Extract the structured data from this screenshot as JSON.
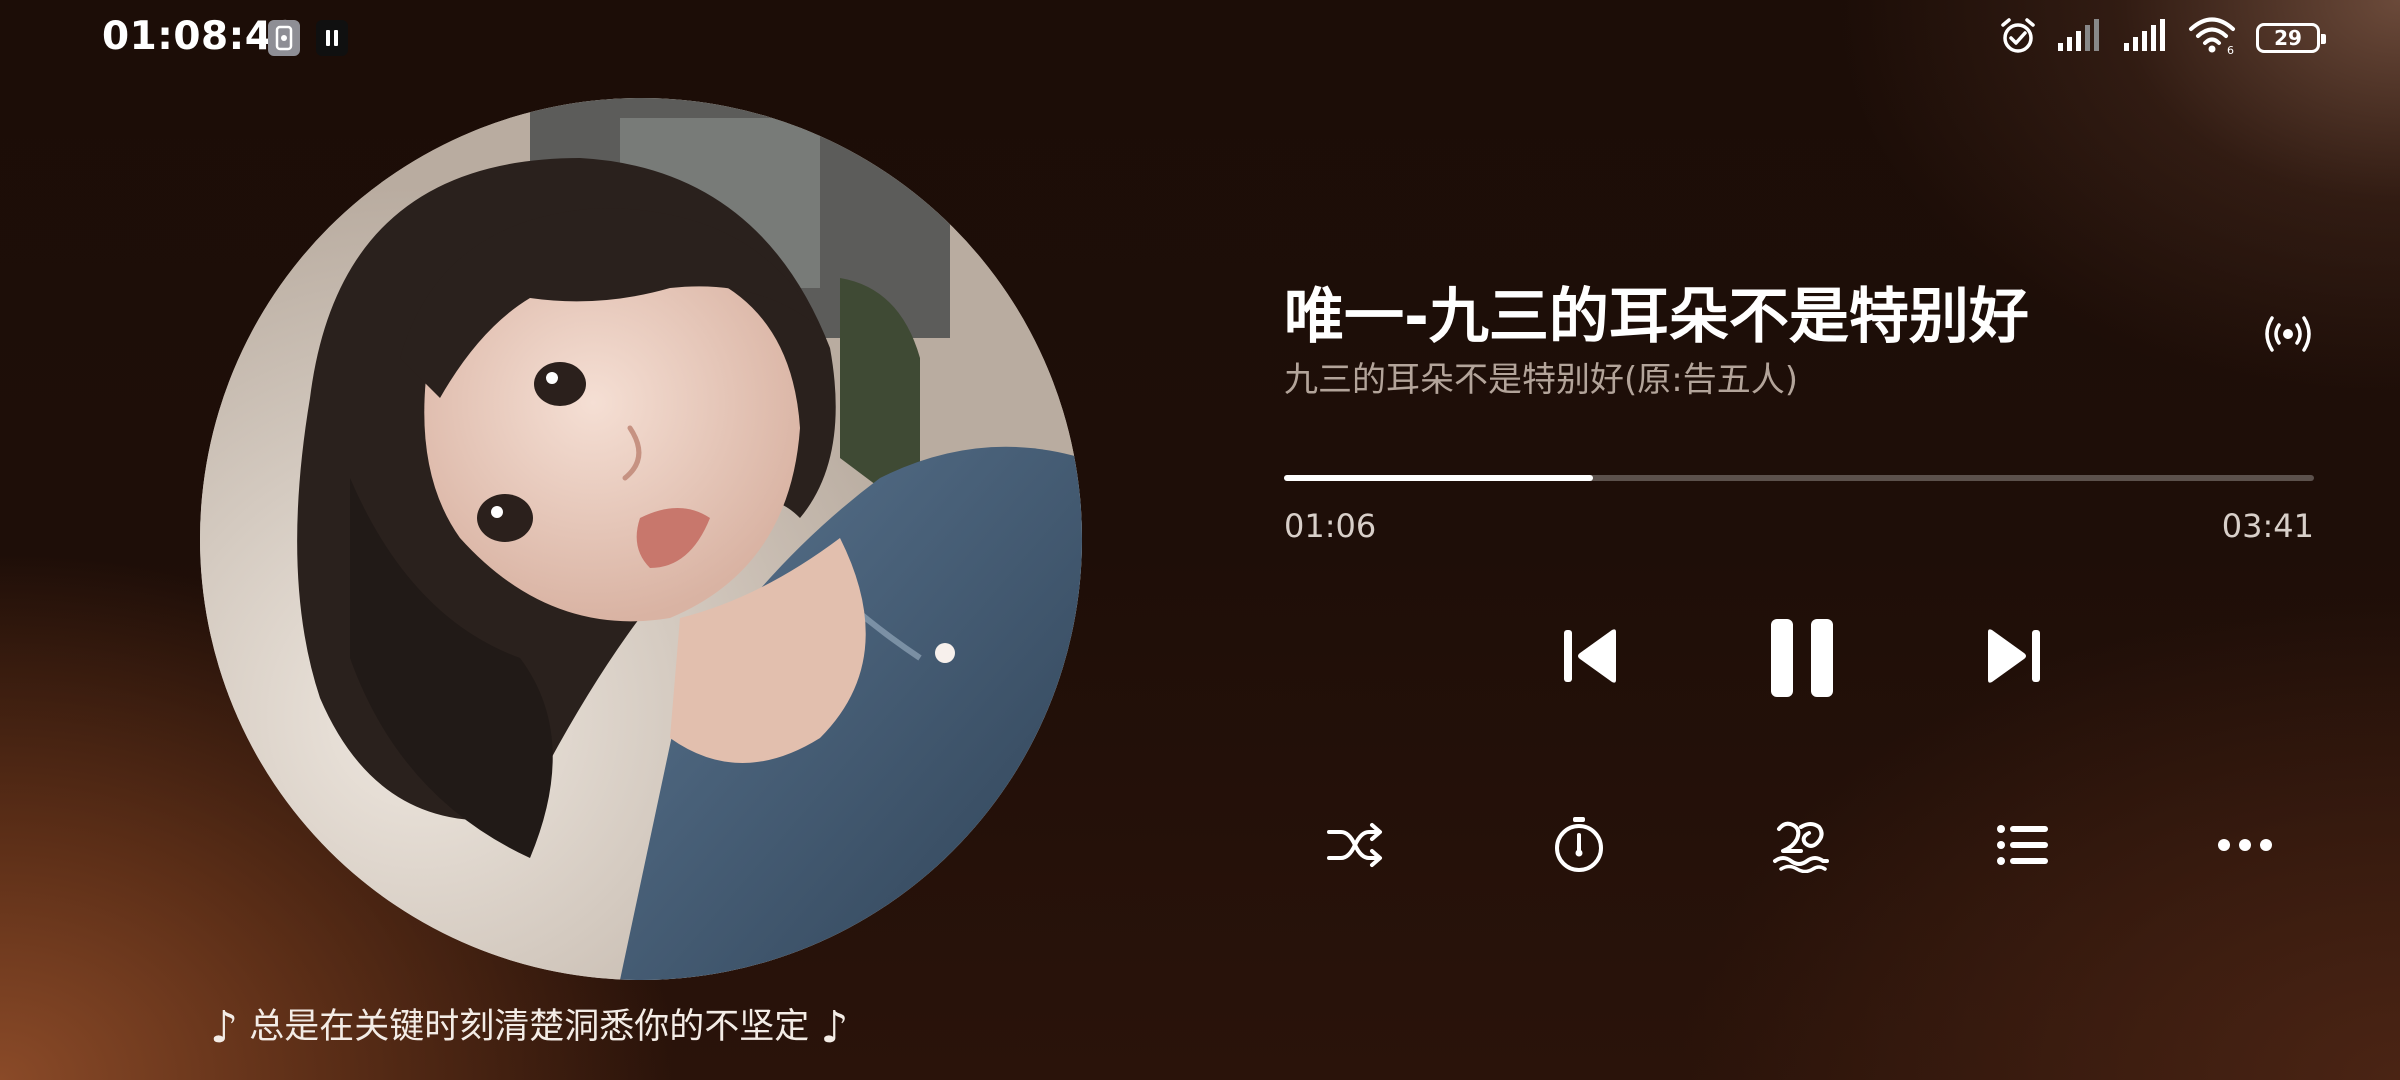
{
  "status_bar": {
    "time": "01:08:49",
    "battery": "29",
    "icons": [
      "screen-cast-icon",
      "pause-icon",
      "alarm-icon",
      "signal-icon",
      "signal-icon",
      "wifi-icon",
      "battery-icon"
    ]
  },
  "album": {
    "art_icon": "album-cover-photo"
  },
  "lyric": {
    "note": "♪",
    "text": "总是在关键时刻清楚洞悉你的不坚定"
  },
  "song": {
    "title": "唯一-九三的耳朵不是特别好",
    "artist": "九三的耳朵不是特别好(原:告五人)"
  },
  "playback": {
    "current_time": "01:06",
    "total_time": "03:41",
    "progress": 0.3
  },
  "controls": {
    "prev_icon": "skip-previous-icon",
    "pause_icon": "pause-icon",
    "next_icon": "skip-next-icon",
    "cast_icon": "broadcast-icon"
  },
  "tools": {
    "shuffle_icon": "shuffle-icon",
    "timer_icon": "timer-icon",
    "effects_icon": "sound-effects-icon",
    "playlist_icon": "playlist-icon",
    "more_icon": "more-icon"
  },
  "colors": {
    "accent": "#ffffff",
    "secondary_text": "#b3a49a",
    "background": "#1e0e08"
  }
}
